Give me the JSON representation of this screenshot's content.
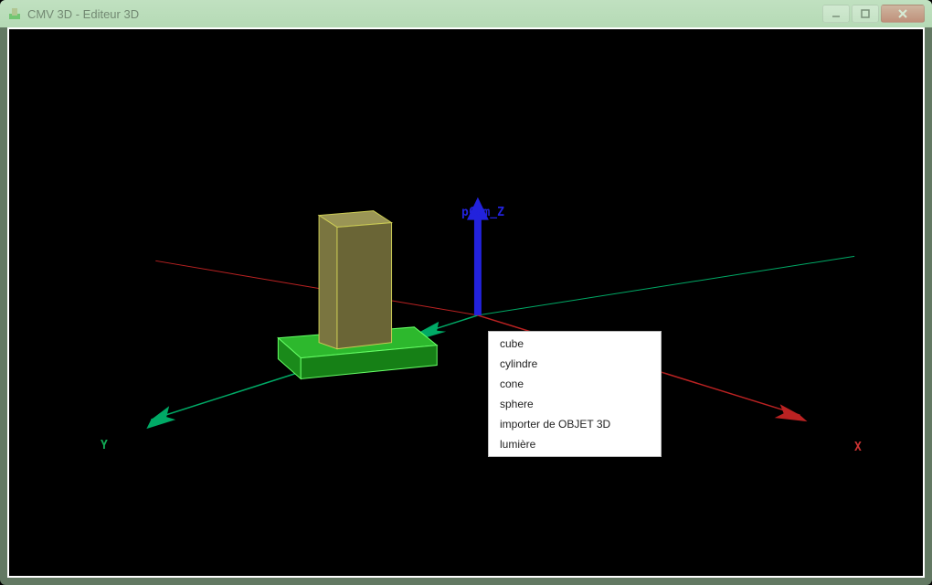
{
  "window": {
    "title": "CMV 3D - Editeur 3D"
  },
  "axes": {
    "x_label": "X",
    "y_label": "Y",
    "z_label": "pCam_Z"
  },
  "context_menu": {
    "items": [
      {
        "label": "cube"
      },
      {
        "label": "cylindre"
      },
      {
        "label": "cone"
      },
      {
        "label": "sphere"
      },
      {
        "label": "importer de OBJET 3D"
      },
      {
        "label": "lumière"
      }
    ]
  },
  "colors": {
    "axis_x": "#cc3333",
    "axis_y": "#11aa55",
    "axis_z": "#2020dd",
    "base_block": "#22aa22",
    "column_block": "#8a8a50"
  }
}
